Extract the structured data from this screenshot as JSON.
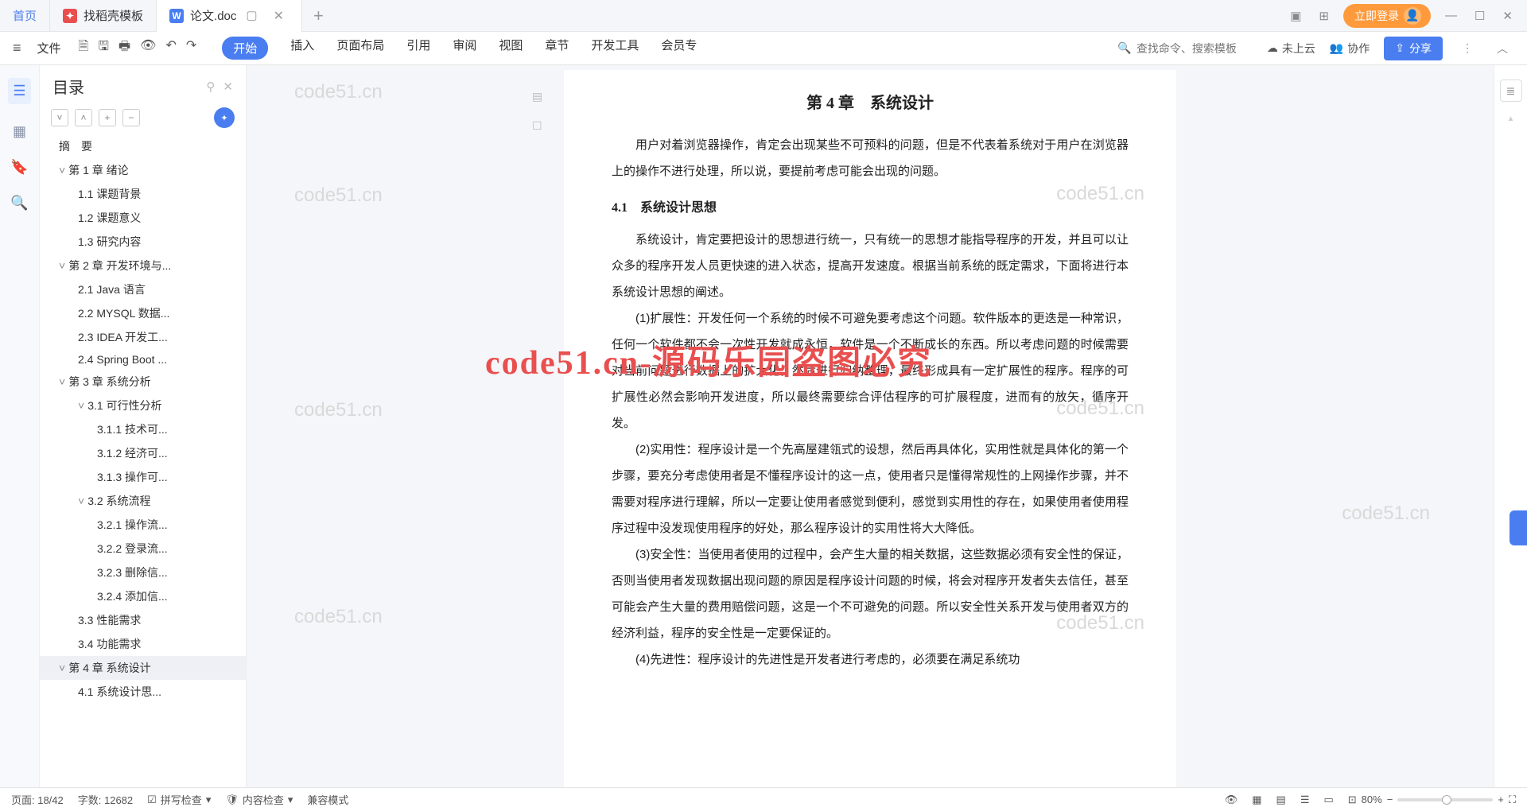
{
  "tabs": {
    "home": "首页",
    "tpl_icon": "",
    "tpl": "找稻壳模板",
    "doc_icon": "W",
    "doc": "论文.doc",
    "add": "+"
  },
  "titlebar": {
    "login": "立即登录",
    "layout_icon": "▣",
    "grid_icon": "⊞",
    "min": "—",
    "max": "☐",
    "close": "✕"
  },
  "ribbon": {
    "menu": "≡",
    "file": "文件",
    "tabs": [
      "开始",
      "插入",
      "页面布局",
      "引用",
      "审阅",
      "视图",
      "章节",
      "开发工具",
      "会员专"
    ],
    "active_index": 0,
    "search_placeholder": "查找命令、搜索模板",
    "cloud": "未上云",
    "collab": "协作",
    "share": "分享"
  },
  "outline": {
    "title": "目录",
    "items": [
      {
        "lvl": 0,
        "txt": "摘　要"
      },
      {
        "lvl": 1,
        "txt": "第 1 章  绪论",
        "chev": true
      },
      {
        "lvl": 2,
        "txt": "1.1  课题背景"
      },
      {
        "lvl": 2,
        "txt": "1.2  课题意义"
      },
      {
        "lvl": 2,
        "txt": "1.3  研究内容"
      },
      {
        "lvl": 1,
        "txt": "第 2 章  开发环境与...",
        "chev": true
      },
      {
        "lvl": 2,
        "txt": "2.1 Java 语言"
      },
      {
        "lvl": 2,
        "txt": "2.2 MYSQL 数据..."
      },
      {
        "lvl": 2,
        "txt": "2.3 IDEA 开发工..."
      },
      {
        "lvl": 2,
        "txt": "2.4 Spring Boot ..."
      },
      {
        "lvl": 1,
        "txt": "第 3 章  系统分析",
        "chev": true
      },
      {
        "lvl": 2,
        "txt": "3.1  可行性分析",
        "chev": true
      },
      {
        "lvl": 3,
        "txt": "3.1.1  技术可..."
      },
      {
        "lvl": 3,
        "txt": "3.1.2  经济可..."
      },
      {
        "lvl": 3,
        "txt": "3.1.3  操作可..."
      },
      {
        "lvl": 2,
        "txt": "3.2  系统流程",
        "chev": true
      },
      {
        "lvl": 3,
        "txt": "3.2.1  操作流..."
      },
      {
        "lvl": 3,
        "txt": "3.2.2  登录流..."
      },
      {
        "lvl": 3,
        "txt": "3.2.3  删除信..."
      },
      {
        "lvl": 3,
        "txt": "3.2.4  添加信..."
      },
      {
        "lvl": 2,
        "txt": "3.3  性能需求"
      },
      {
        "lvl": 2,
        "txt": "3.4  功能需求"
      },
      {
        "lvl": 1,
        "txt": "第 4 章  系统设计",
        "chev": true,
        "sel": true
      },
      {
        "lvl": 2,
        "txt": "4.1  系统设计思..."
      }
    ]
  },
  "document": {
    "chapter_title": "第 4 章　系统设计",
    "p_intro": "用户对着浏览器操作，肯定会出现某些不可预料的问题，但是不代表着系统对于用户在浏览器上的操作不进行处理，所以说，要提前考虑可能会出现的问题。",
    "s41": "4.1　系统设计思想",
    "p41": "系统设计，肯定要把设计的思想进行统一，只有统一的思想才能指导程序的开发，并且可以让众多的程序开发人员更快速的进入状态，提高开发速度。根据当前系统的既定需求，下面将进行本系统设计思想的阐述。",
    "p_ext": "(1)扩展性：开发任何一个系统的时候不可避免要考虑这个问题。软件版本的更迭是一种常识，任何一个软件都不会一次性开发就成永恒，软件是一个不断成长的东西。所以考虑问题的时候需要对当前问题进行数据上的扩大化，然后进行归纳整理，最终形成具有一定扩展性的程序。程序的可扩展性必然会影响开发进度，所以最终需要综合评估程序的可扩展程度，进而有的放矢，循序开发。",
    "p_use": "(2)实用性：程序设计是一个先高屋建瓴式的设想，然后再具体化，实用性就是具体化的第一个步骤，要充分考虑使用者是不懂程序设计的这一点，使用者只是懂得常规性的上网操作步骤，并不需要对程序进行理解，所以一定要让使用者感觉到便利，感觉到实用性的存在，如果使用者使用程序过程中没发现使用程序的好处，那么程序设计的实用性将大大降低。",
    "p_sec": "(3)安全性：当使用者使用的过程中，会产生大量的相关数据，这些数据必须有安全性的保证，否则当使用者发现数据出现问题的原因是程序设计问题的时候，将会对程序开发者失去信任，甚至可能会产生大量的费用赔偿问题，这是一个不可避免的问题。所以安全性关系开发与使用者双方的经济利益，程序的安全性是一定要保证的。",
    "p_adv": "(4)先进性：程序设计的先进性是开发者进行考虑的，必须要在满足系统功"
  },
  "watermarks": {
    "gray": "code51.cn",
    "red": "code51.cn-源码乐园盗图必究"
  },
  "status": {
    "page": "页面: 18/42",
    "words": "字数: 12682",
    "spell": "拼写检查",
    "content": "内容检查",
    "compat": "兼容模式",
    "zoom": "80%"
  }
}
